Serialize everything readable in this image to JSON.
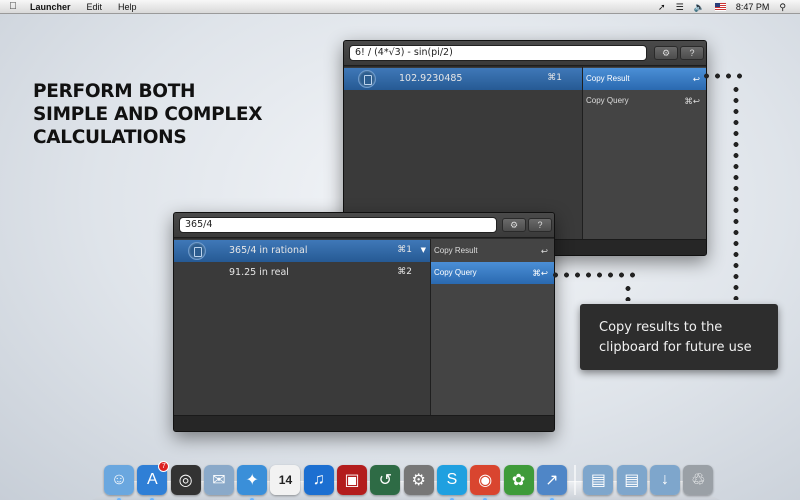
{
  "menubar": {
    "app_name": "Launcher",
    "menus": [
      "Edit",
      "Help"
    ],
    "clock": "8:47 PM"
  },
  "headline": {
    "lines": [
      "PERFORM BOTH",
      "SIMPLE AND COMPLEX",
      "CALCULATIONS"
    ]
  },
  "window_back": {
    "query": "6! / (4*√3) - sin(pi/2)",
    "results": [
      {
        "text": "102.9230485",
        "shortcut": "⌘1",
        "selected": true
      }
    ],
    "actions": [
      {
        "label": "Copy Result",
        "shortcut": "↩",
        "selected": true
      },
      {
        "label": "Copy Query",
        "shortcut": "⌘↩",
        "selected": false
      }
    ],
    "settings_icon": "gear-icon",
    "help_label": "?"
  },
  "window_front": {
    "query": "365/4",
    "results": [
      {
        "text": "365/4 in rational",
        "shortcut": "⌘1",
        "selected": true
      },
      {
        "text": "91.25 in real",
        "shortcut": "⌘2",
        "selected": false
      }
    ],
    "actions": [
      {
        "label": "Copy Result",
        "shortcut": "↩",
        "selected": false
      },
      {
        "label": "Copy Query",
        "shortcut": "⌘↩",
        "selected": true
      }
    ],
    "settings_icon": "gear-icon",
    "help_label": "?"
  },
  "callout": {
    "lines": [
      "Copy results to the",
      "clipboard for future use"
    ]
  },
  "dock": {
    "items": [
      {
        "name": "finder-icon",
        "glyph": "☺",
        "color": "#6aa7df"
      },
      {
        "name": "app-store-icon",
        "glyph": "A",
        "color": "#2f7fd6",
        "badge": "7"
      },
      {
        "name": "dashboard-icon",
        "glyph": "◎",
        "color": "#333"
      },
      {
        "name": "mail-icon",
        "glyph": "✉",
        "color": "#8aa9c9"
      },
      {
        "name": "safari-icon",
        "glyph": "✦",
        "color": "#3a8fd9"
      },
      {
        "name": "calendar-icon",
        "glyph": "14",
        "color": "#f2f2f2"
      },
      {
        "name": "itunes-icon",
        "glyph": "♫",
        "color": "#1c6fd1"
      },
      {
        "name": "photo-booth-icon",
        "glyph": "▣",
        "color": "#b31d1d"
      },
      {
        "name": "time-machine-icon",
        "glyph": "↺",
        "color": "#2e6b45"
      },
      {
        "name": "system-preferences-icon",
        "glyph": "⚙",
        "color": "#777"
      },
      {
        "name": "skype-icon",
        "glyph": "S",
        "color": "#1fa0e0"
      },
      {
        "name": "chrome-icon",
        "glyph": "◉",
        "color": "#d9452f"
      },
      {
        "name": "adium-icon",
        "glyph": "✿",
        "color": "#3f9b3a"
      },
      {
        "name": "launcher-icon",
        "glyph": "↗",
        "color": "#4f86c7"
      },
      {
        "name": "applications-folder-icon",
        "glyph": "▤",
        "color": "#7ea6cc"
      },
      {
        "name": "documents-folder-icon",
        "glyph": "▤",
        "color": "#7ea6cc"
      },
      {
        "name": "downloads-folder-icon",
        "glyph": "↓",
        "color": "#7ea6cc"
      },
      {
        "name": "trash-icon",
        "glyph": "♲",
        "color": "#9aa0a6"
      }
    ]
  }
}
